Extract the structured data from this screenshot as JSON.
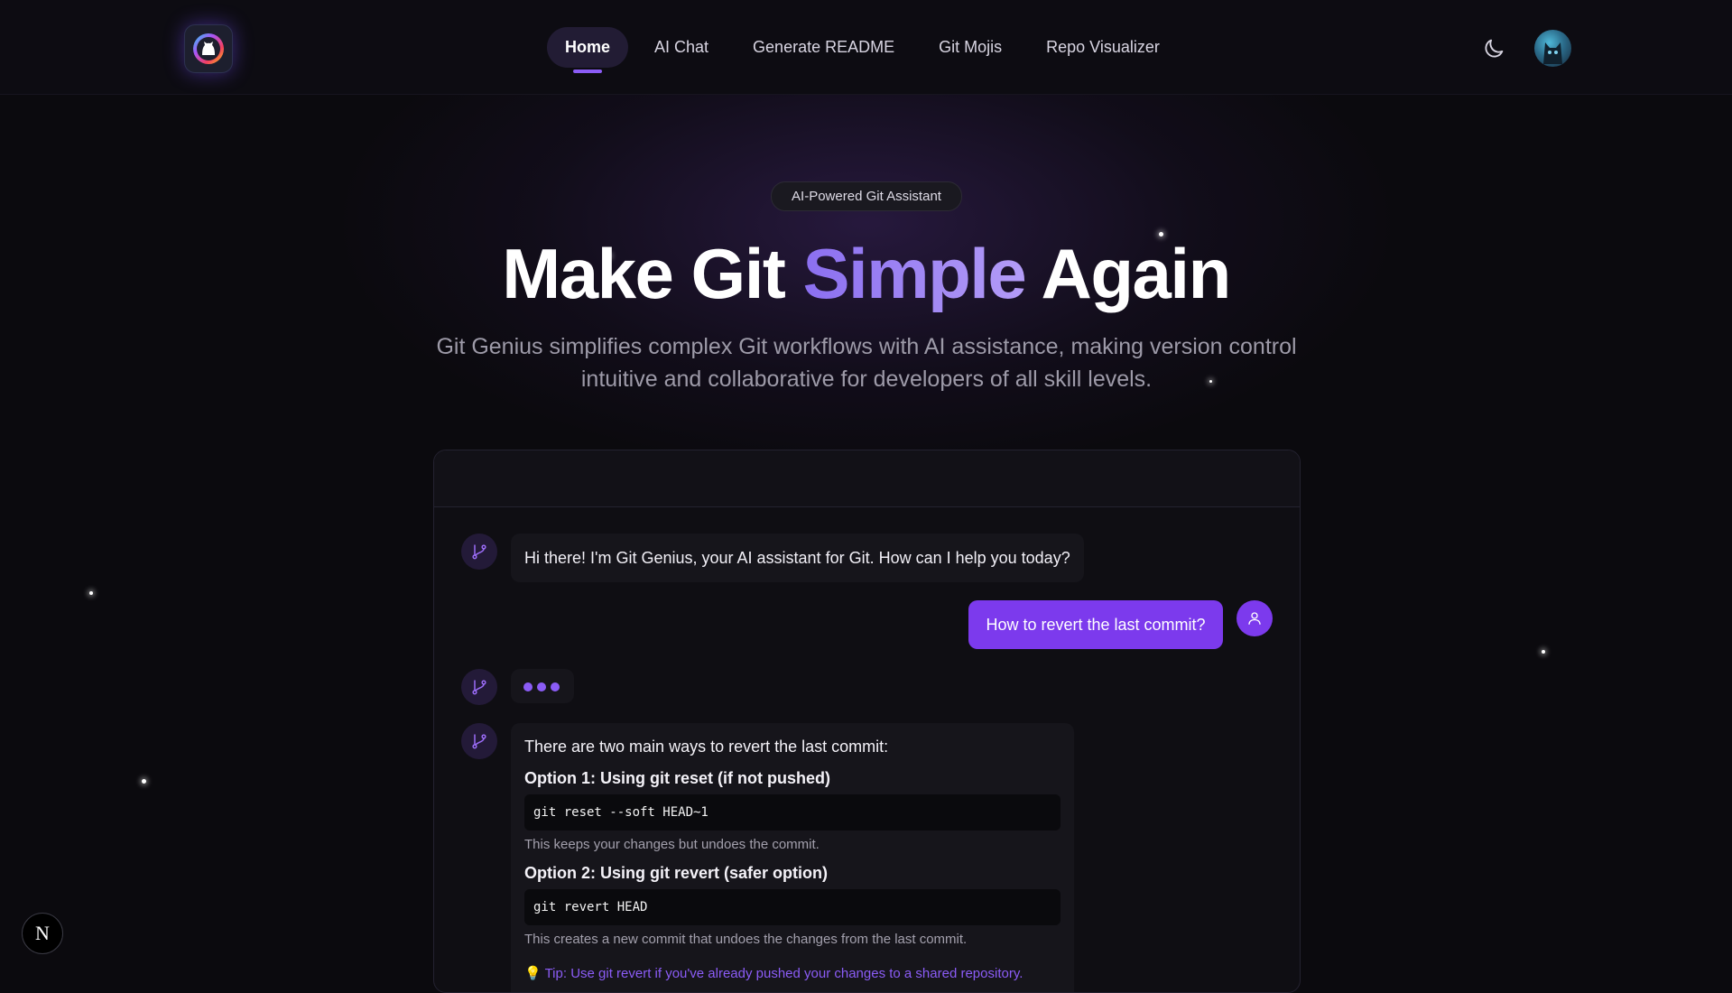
{
  "nav": {
    "logo_icon": "github-octocat-logo",
    "links": [
      {
        "label": "Home",
        "active": true
      },
      {
        "label": "AI Chat",
        "active": false
      },
      {
        "label": "Generate README",
        "active": false
      },
      {
        "label": "Git Mojis",
        "active": false
      },
      {
        "label": "Repo Visualizer",
        "active": false
      }
    ],
    "theme_icon": "moon-icon",
    "avatar_icon": "user-avatar"
  },
  "hero": {
    "badge": "AI-Powered Git Assistant",
    "title_part1": "Make Git ",
    "title_accent": "Simple",
    "title_part2": " Again",
    "subtitle": "Git Genius simplifies complex Git workflows with AI assistance, making version control intuitive and collaborative for developers of all skill levels."
  },
  "chat": {
    "bot_icon": "git-branch-icon",
    "user_icon": "user-icon",
    "greeting": "Hi there! I'm Git Genius, your AI assistant for Git. How can I help you today?",
    "user_message": "How to revert the last commit?",
    "answer": {
      "intro": "There are two main ways to revert the last commit:",
      "option1_title": "Option 1: Using git reset (if not pushed)",
      "option1_code": "git reset --soft HEAD~1",
      "option1_note": "This keeps your changes but undoes the commit.",
      "option2_title": "Option 2: Using git revert (safer option)",
      "option2_code": "git revert HEAD",
      "option2_note": "This creates a new commit that undoes the changes from the last commit.",
      "tip": "💡 Tip: Use git revert if you've already pushed your changes to a shared repository."
    }
  },
  "dev_badge": {
    "label": "N"
  },
  "colors": {
    "accent": "#7c3aed",
    "accent_light": "#8b5cf6",
    "background": "#0b0a0e"
  }
}
